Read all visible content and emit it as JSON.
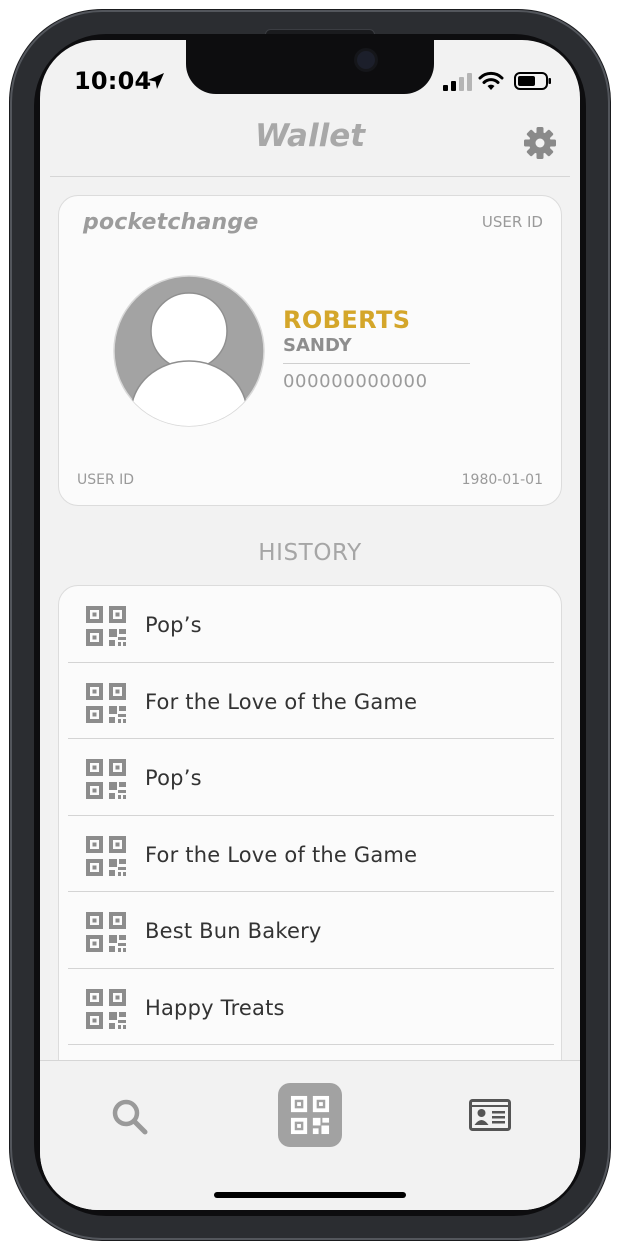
{
  "status_bar": {
    "time": "10:04",
    "icons": [
      "location-arrow-icon",
      "cellular-signal-icon",
      "wifi-icon",
      "battery-icon"
    ]
  },
  "header": {
    "title": "Wallet",
    "settings_icon": "gear-icon"
  },
  "card": {
    "brand": "pocketchange",
    "user_id_label_top": "USER ID",
    "last_name": "ROBERTS",
    "first_name": "SANDY",
    "id_number": "000000000000",
    "user_id_label_bottom": "USER ID",
    "date_of_birth": "1980-01-01",
    "avatar_icon": "avatar-placeholder-icon"
  },
  "history": {
    "heading": "HISTORY",
    "items": [
      {
        "label": "Pop’s",
        "icon": "qr-code-icon"
      },
      {
        "label": "For the Love of the Game",
        "icon": "qr-code-icon"
      },
      {
        "label": "Pop’s",
        "icon": "qr-code-icon"
      },
      {
        "label": "For the Love of the Game",
        "icon": "qr-code-icon"
      },
      {
        "label": "Best Bun Bakery",
        "icon": "qr-code-icon"
      },
      {
        "label": "Happy Treats",
        "icon": "qr-code-icon"
      },
      {
        "label": "",
        "icon": "qr-code-icon"
      }
    ]
  },
  "tab_bar": {
    "tabs": [
      {
        "name": "search",
        "icon": "search-icon",
        "active": false
      },
      {
        "name": "scan",
        "icon": "qr-code-icon",
        "active": true
      },
      {
        "name": "id-card",
        "icon": "id-card-icon",
        "active": false
      }
    ]
  },
  "colors": {
    "accent_gold": "#d4a62a",
    "muted_gray": "#a8a8a8",
    "screen_bg": "#f2f2f2",
    "active_tab_bg": "#a2a2a2"
  }
}
